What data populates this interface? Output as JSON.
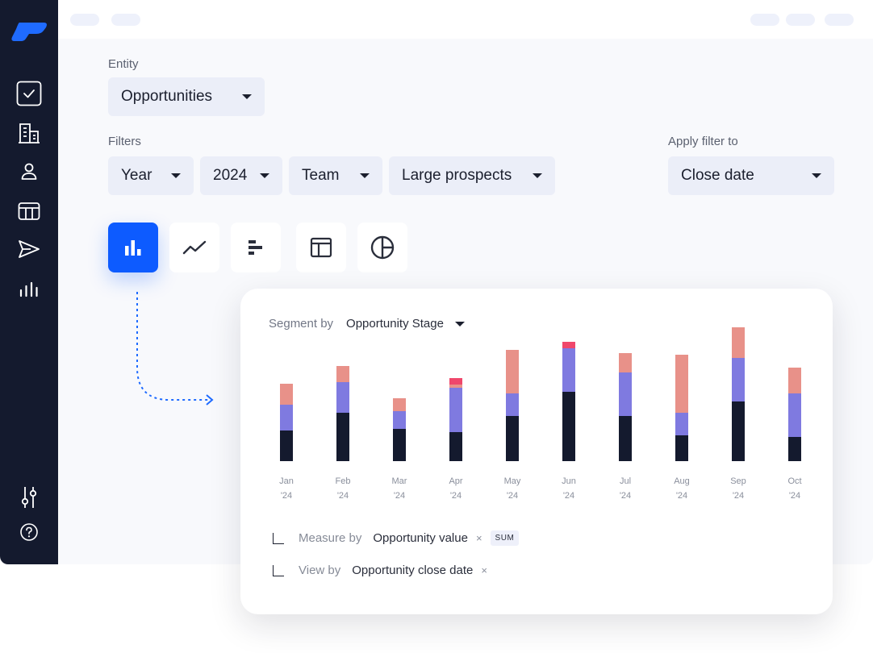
{
  "entity": {
    "label": "Entity",
    "value": "Opportunities"
  },
  "filters": {
    "label": "Filters",
    "items": [
      "Year",
      "2024",
      "Team",
      "Large prospects"
    ]
  },
  "apply_filter": {
    "label": "Apply filter to",
    "value": "Close date"
  },
  "sidebar": {
    "items": [
      "logo-icon",
      "tasks-icon",
      "building-icon",
      "person-icon",
      "table-icon",
      "send-icon",
      "chart-icon",
      "sliders-icon",
      "help-icon"
    ]
  },
  "chart_types": [
    "bar-chart-icon",
    "line-chart-icon",
    "horizontal-bar-icon",
    "table-layout-icon",
    "pie-chart-icon"
  ],
  "card": {
    "segment_label": "Segment by",
    "segment_value": "Opportunity Stage",
    "measure_label": "Measure by",
    "measure_value": "Opportunity value",
    "measure_agg": "SUM",
    "view_label": "View by",
    "view_value": "Opportunity close date",
    "remove_glyph": "×"
  },
  "colors": {
    "accent": "#0d5bff",
    "sidebar": "#141a2e",
    "series_dark": "#141a2e",
    "series_purple": "#7f7ae0",
    "series_salmon": "#e89189",
    "series_red": "#f0476b"
  },
  "chart_data": {
    "type": "bar",
    "stacked": true,
    "categories": [
      "Jan '24",
      "Feb '24",
      "Mar '24",
      "Apr '24",
      "May '24",
      "Jun '24",
      "Jul '24",
      "Aug '24",
      "Sep '24",
      "Oct '24"
    ],
    "tick_top": [
      "Jan",
      "Feb",
      "Mar",
      "Apr",
      "May",
      "Jun",
      "Jul",
      "Aug",
      "Sep",
      "Oct"
    ],
    "tick_bottom": [
      "'24",
      "'24",
      "'24",
      "'24",
      "'24",
      "'24",
      "'24",
      "'24",
      "'24",
      "'24"
    ],
    "series": [
      {
        "color": "#141a2e",
        "values": [
          38,
          60,
          40,
          36,
          56,
          86,
          56,
          32,
          74,
          30
        ]
      },
      {
        "color": "#7f7ae0",
        "values": [
          32,
          38,
          22,
          55,
          28,
          54,
          54,
          28,
          54,
          54
        ]
      },
      {
        "color": "#e89189",
        "values": [
          26,
          20,
          16,
          4,
          54,
          0,
          24,
          72,
          38,
          32
        ]
      },
      {
        "color": "#f0476b",
        "values": [
          0,
          0,
          0,
          8,
          0,
          8,
          0,
          0,
          0,
          0
        ]
      }
    ],
    "ylim": [
      0,
      170
    ],
    "grid": false,
    "legend": "none"
  }
}
